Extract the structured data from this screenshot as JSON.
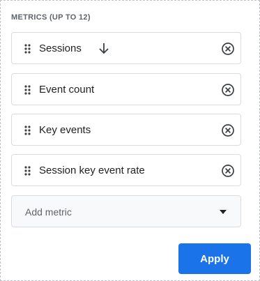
{
  "section_title": "METRICS (UP TO 12)",
  "metrics": [
    {
      "label": "Sessions",
      "sorted_descending": true
    },
    {
      "label": "Event count"
    },
    {
      "label": "Key events"
    },
    {
      "label": "Session key event rate"
    }
  ],
  "add_metric": {
    "placeholder": "Add metric"
  },
  "apply_label": "Apply",
  "icons": {
    "drag": "drag-handle-icon",
    "sort": "arrow-down-icon",
    "remove": "close-circle-icon",
    "dropdown": "caret-down-icon"
  },
  "colors": {
    "primary": "#1a73e8",
    "text": "#202124",
    "muted": "#5f6368",
    "border": "#dadce0"
  }
}
